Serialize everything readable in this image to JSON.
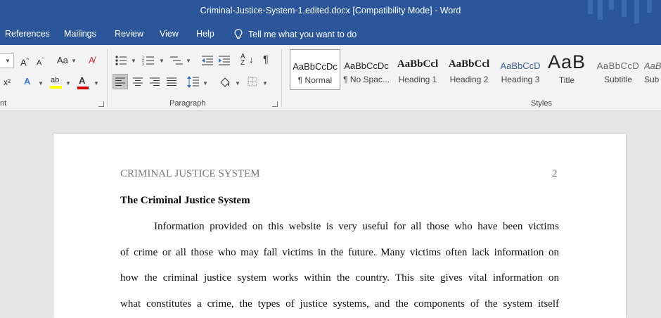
{
  "window": {
    "title": "Criminal-Justice-System-1.edited.docx [Compatibility Mode]  -  Word"
  },
  "menu": {
    "tabs": [
      "References",
      "Mailings",
      "Review",
      "View",
      "Help"
    ],
    "tell_me": "Tell me what you want to do"
  },
  "ribbon": {
    "groups": {
      "font_label": "nt",
      "paragraph_label": "Paragraph",
      "styles_label": "Styles"
    },
    "styles": [
      {
        "sample": "AaBbCcDc",
        "name": "¶ Normal",
        "selected": true
      },
      {
        "sample": "AaBbCcDc",
        "name": "¶ No Spac..."
      },
      {
        "sample": "AaBbCcl",
        "name": "Heading 1"
      },
      {
        "sample": "AaBbCcl",
        "name": "Heading 2"
      },
      {
        "sample": "AaBbCcD",
        "name": "Heading 3"
      },
      {
        "sample": "AaB",
        "name": "Title"
      },
      {
        "sample": "AaBbCcD",
        "name": "Subtitle"
      },
      {
        "sample": "AaBl",
        "name": "Sub"
      }
    ],
    "colors": {
      "highlight": "#ffff00",
      "font_color": "#d20000"
    }
  },
  "document": {
    "running_header": "CRIMINAL JUSTICE SYSTEM",
    "page_number": "2",
    "heading": "The Criminal Justice System",
    "lines": [
      "Information provided on this website is very useful for all those who have been victims",
      "of crime or all those who may fall victims in the future. Many victims often lack information on",
      "how the criminal justice system works within the country. This site gives vital information on",
      "what constitutes a crime, the types of justice systems, and the components of the system itself"
    ]
  },
  "theme": {
    "title_bar": "#2b579a",
    "ribbon_bg": "#f3f3f3",
    "canvas_bg": "#e6e6e6"
  }
}
